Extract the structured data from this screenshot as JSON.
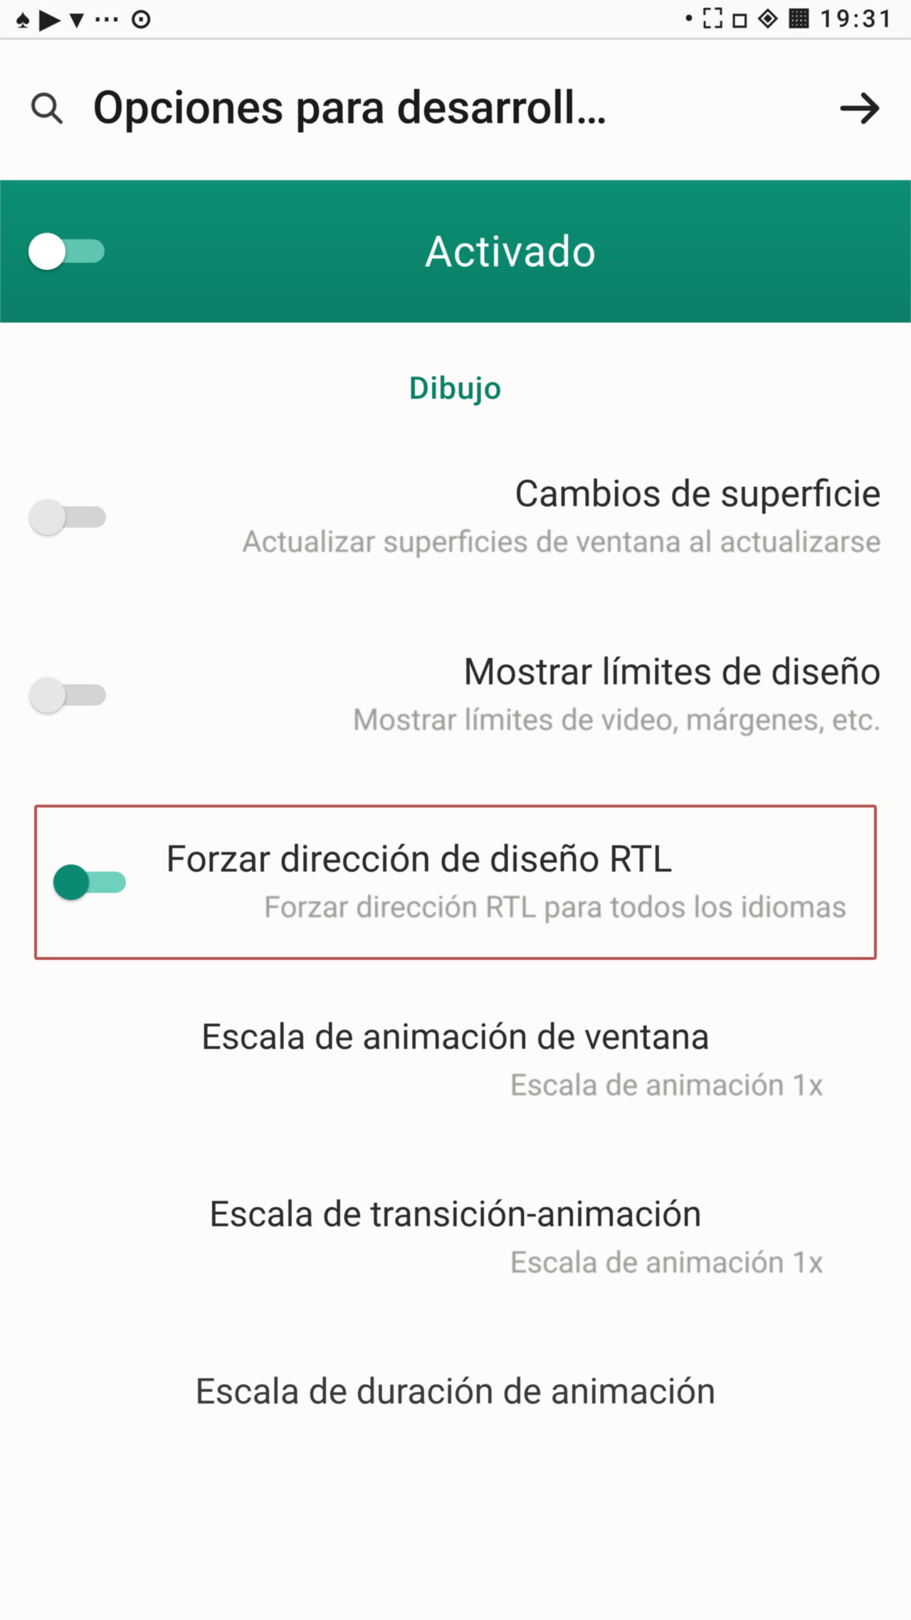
{
  "statusbar": {
    "left_glyphs": "♠ ▶ ▾ ⋯ ⊙",
    "right_glyphs": "• ⛶ ◻ ◈ ▦",
    "time": "19:31"
  },
  "header": {
    "title": "Opciones para desarroll…"
  },
  "activated": {
    "label": "Activado"
  },
  "section_label": "Dibujo",
  "settings": {
    "surface": {
      "title": "Cambios de superficie",
      "sub": "Actualizar superficies de ventana al actualizarse",
      "enabled": false
    },
    "limits": {
      "title": "Mostrar límites de diseño",
      "sub": "Mostrar límites de video, márgenes, etc.",
      "enabled": false
    },
    "rtl": {
      "title": "Forzar dirección de diseño RTL",
      "sub": "Forzar dirección RTL para todos los idiomas",
      "enabled": true
    }
  },
  "entries": {
    "window_anim": {
      "title": "Escala de animación de ventana",
      "sub": "Escala de animación 1x"
    },
    "trans_anim": {
      "title": "Escala de transición-animación",
      "sub": "Escala de animación 1x"
    },
    "dur_anim": {
      "title": "Escala de duración de animación"
    }
  },
  "colors": {
    "accent": "#0b8a71",
    "highlight_border": "#b3534f"
  }
}
